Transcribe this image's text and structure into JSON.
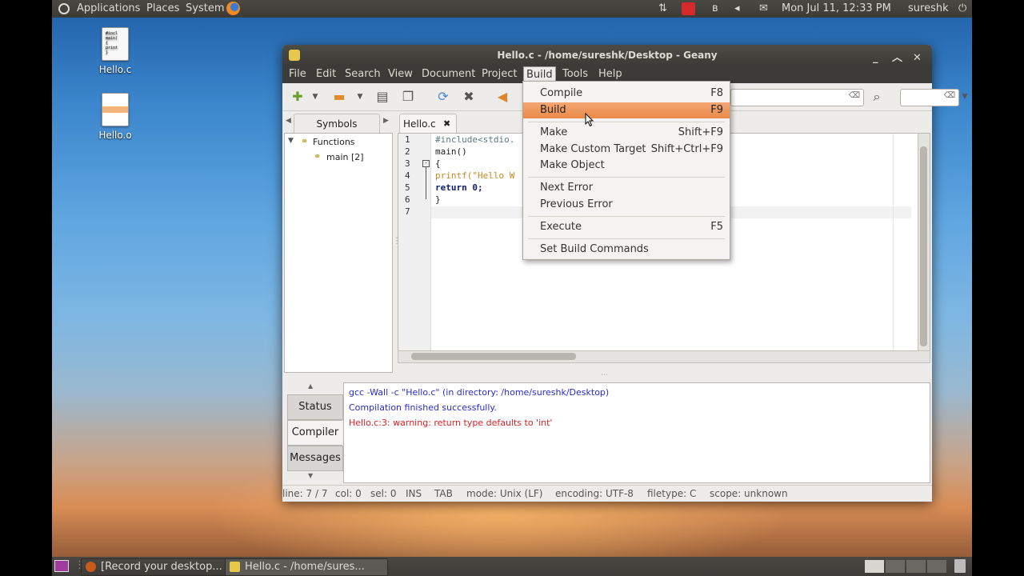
{
  "top_panel": {
    "menus": [
      "Applications",
      "Places",
      "System"
    ],
    "clock": "Mon Jul 11, 12:33 PM",
    "user": "sureshk"
  },
  "desktop_icons": [
    {
      "label": "Hello.c",
      "preview": "#incl\nmain(\n{\nprint\n}"
    },
    {
      "label": "Hello.o"
    }
  ],
  "window": {
    "title": "Hello.c - /home/sureshk/Desktop - Geany",
    "menu": [
      "File",
      "Edit",
      "Search",
      "View",
      "Document",
      "Project",
      "Build",
      "Tools",
      "Help"
    ]
  },
  "sidebar": {
    "tab": "Symbols",
    "tree": {
      "group": "Functions",
      "item": "main [2]"
    }
  },
  "editor": {
    "tab": "Hello.c",
    "lines": [
      {
        "n": "1",
        "text": "#include<stdio."
      },
      {
        "n": "2",
        "text": "main()"
      },
      {
        "n": "3",
        "text": "{"
      },
      {
        "n": "4",
        "text": "printf(\"Hello W"
      },
      {
        "n": "5",
        "text": "return 0;"
      },
      {
        "n": "6",
        "text": "}"
      },
      {
        "n": "7",
        "text": ""
      }
    ]
  },
  "build_menu": {
    "items": [
      {
        "label": "Compile",
        "key": "F8"
      },
      {
        "label": "Build",
        "key": "F9"
      },
      {
        "label": "Make",
        "key": "Shift+F9"
      },
      {
        "label": "Make Custom Target",
        "key": "Shift+Ctrl+F9"
      },
      {
        "label": "Make Object",
        "key": ""
      },
      {
        "label": "Next Error",
        "key": ""
      },
      {
        "label": "Previous Error",
        "key": ""
      },
      {
        "label": "Execute",
        "key": "F5"
      },
      {
        "label": "Set Build Commands",
        "key": ""
      }
    ]
  },
  "message_window": {
    "tabs": [
      "Status",
      "Compiler",
      "Messages"
    ],
    "active_tab": "Compiler",
    "lines": [
      {
        "text": "gcc -Wall -c \"Hello.c\" (in directory: /home/sureshk/Desktop)",
        "color": "#2a2ad0"
      },
      {
        "text": "Compilation finished successfully.",
        "color": "#2a2ad0"
      },
      {
        "text": "Hello.c:3: warning: return type defaults to 'int'",
        "color": "#e02020"
      }
    ]
  },
  "statusbar": {
    "line": "line: 7 / 7",
    "col": "col: 0",
    "sel": "sel: 0",
    "ins": "INS",
    "tab": "TAB",
    "mode": "mode: Unix (LF)",
    "encoding": "encoding: UTF-8",
    "filetype": "filetype: C",
    "scope": "scope: unknown"
  },
  "taskbar": {
    "tasks": [
      "[Record your desktop...",
      "Hello.c - /home/sures..."
    ]
  }
}
